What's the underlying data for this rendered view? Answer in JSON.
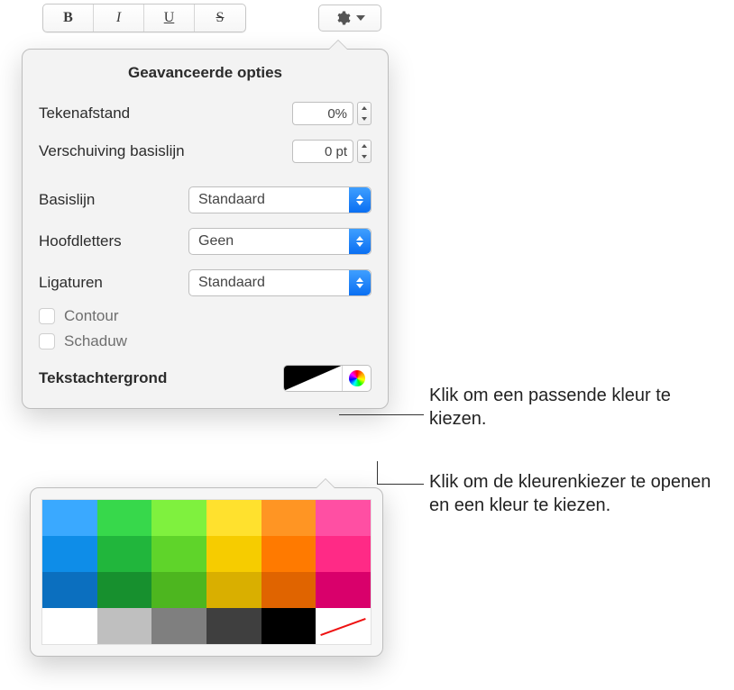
{
  "toolbar": {
    "bold": "B",
    "italic": "I",
    "underline": "U",
    "strike": "S"
  },
  "popover": {
    "title": "Geavanceerde opties",
    "char_spacing_label": "Tekenafstand",
    "char_spacing_value": "0%",
    "baseline_shift_label": "Verschuiving basislijn",
    "baseline_shift_value": "0 pt",
    "baseline_label": "Basislijn",
    "baseline_value": "Standaard",
    "caps_label": "Hoofdletters",
    "caps_value": "Geen",
    "ligatures_label": "Ligaturen",
    "ligatures_value": "Standaard",
    "outline_label": "Contour",
    "shadow_label": "Schaduw",
    "text_bg_label": "Tekstachtergrond"
  },
  "palette": {
    "rows": [
      [
        "#3aa9ff",
        "#37d84b",
        "#7ff13e",
        "#ffe12e",
        "#ff9523",
        "#ff4fa3"
      ],
      [
        "#0e8de8",
        "#21b63c",
        "#5fd42a",
        "#f6cc00",
        "#ff7a00",
        "#ff2a86"
      ],
      [
        "#0b6fbf",
        "#17902e",
        "#4db61f",
        "#d9af00",
        "#e06400",
        "#d9006b"
      ],
      [
        "#ffffff",
        "#bfbfbf",
        "#7f7f7f",
        "#3f3f3f",
        "#000000",
        "none"
      ]
    ]
  },
  "callouts": {
    "swatch": "Klik om een passende kleur te kiezen.",
    "wheel": "Klik om de kleurenkiezer te openen en een kleur te kiezen."
  }
}
